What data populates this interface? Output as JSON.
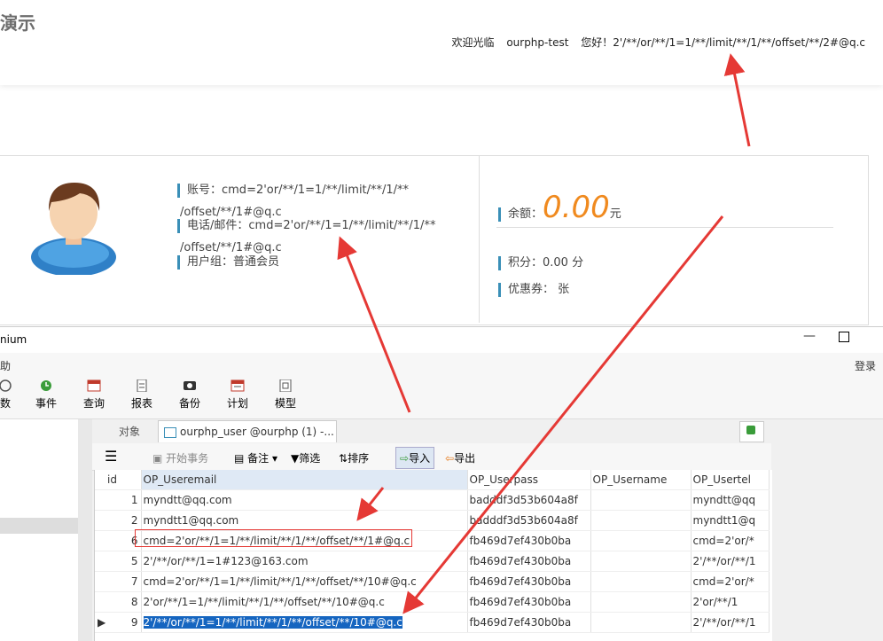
{
  "web": {
    "site_title": "演示",
    "welcome_label": "欢迎光临",
    "site_user": "ourphp-test",
    "greeting": "您好！2'/**/or/**/1=1/**/limit/**/1/**/offset/**/2#@q.c",
    "account_label": "账号：cmd=2'or/**/1=1/**/limit/**/1/**",
    "account_label_cont": "/offset/**/1#@q.c",
    "phone_label": "电话/邮件：cmd=2'or/**/1=1/**/limit/**/1/**",
    "phone_label_cont": "/offset/**/1#@q.c",
    "group_label": "用户组：普通会员",
    "balance_label": "余额：",
    "balance_amount": "0.00",
    "balance_unit": "元",
    "points_label": "积分：0.00 分",
    "coupon_label": "优惠券： 张"
  },
  "window": {
    "title": "nium",
    "menu_left": "助",
    "login": "登录",
    "toolbar": [
      {
        "label": "数",
        "icon": "function-icon"
      },
      {
        "label": "事件",
        "icon": "event-icon"
      },
      {
        "label": "查询",
        "icon": "query-icon"
      },
      {
        "label": "报表",
        "icon": "report-icon"
      },
      {
        "label": "备份",
        "icon": "backup-icon"
      },
      {
        "label": "计划",
        "icon": "schedule-icon"
      },
      {
        "label": "模型",
        "icon": "model-icon"
      }
    ],
    "tab_objects": "对象",
    "tab_active": "ourphp_user @ourphp (1) -...",
    "grid_toolbar": {
      "begin_tx": "开始事务",
      "note": "备注",
      "filter": "筛选",
      "sort": "排序",
      "import": "导入",
      "export": "导出"
    },
    "columns": [
      "id",
      "OP_Useremail",
      "OP_Userpass",
      "OP_Username",
      "OP_Usertel"
    ],
    "rows": [
      {
        "id": "1",
        "email": "myndtt@qq.com",
        "pass": "badddf3d53b604a8f",
        "name": "",
        "tel": "myndtt@qq"
      },
      {
        "id": "2",
        "email": "myndtt1@qq.com",
        "pass": "badddf3d53b604a8f",
        "name": "",
        "tel": "myndtt1@q"
      },
      {
        "id": "6",
        "email": "cmd=2'or/**/1=1/**/limit/**/1/**/offset/**/1#@q.c",
        "pass": "fb469d7ef430b0ba",
        "name": "",
        "tel": "cmd=2'or/*"
      },
      {
        "id": "5",
        "email": "2'/**/or/**/1=1#123@163.com",
        "pass": "fb469d7ef430b0ba",
        "name": "",
        "tel": "2'/**/or/**/1"
      },
      {
        "id": "7",
        "email": "cmd=2'or/**/1=1/**/limit/**/1/**/offset/**/10#@q.c",
        "pass": "fb469d7ef430b0ba",
        "name": "",
        "tel": "cmd=2'or/*"
      },
      {
        "id": "8",
        "email": "2'or/**/1=1/**/limit/**/1/**/offset/**/10#@q.c",
        "pass": "fb469d7ef430b0ba",
        "name": "",
        "tel": "2'or/**/1"
      },
      {
        "id": "9",
        "email": "2'/**/or/**/1=1/**/limit/**/1/**/offset/**/10#@q.c",
        "pass": "fb469d7ef430b0ba",
        "name": "",
        "tel": "2'/**/or/**/1"
      }
    ]
  },
  "colors": {
    "arrow": "#e53935",
    "accent": "#3a8fb7",
    "balance": "#f08a1f",
    "selection": "#1565c0"
  }
}
